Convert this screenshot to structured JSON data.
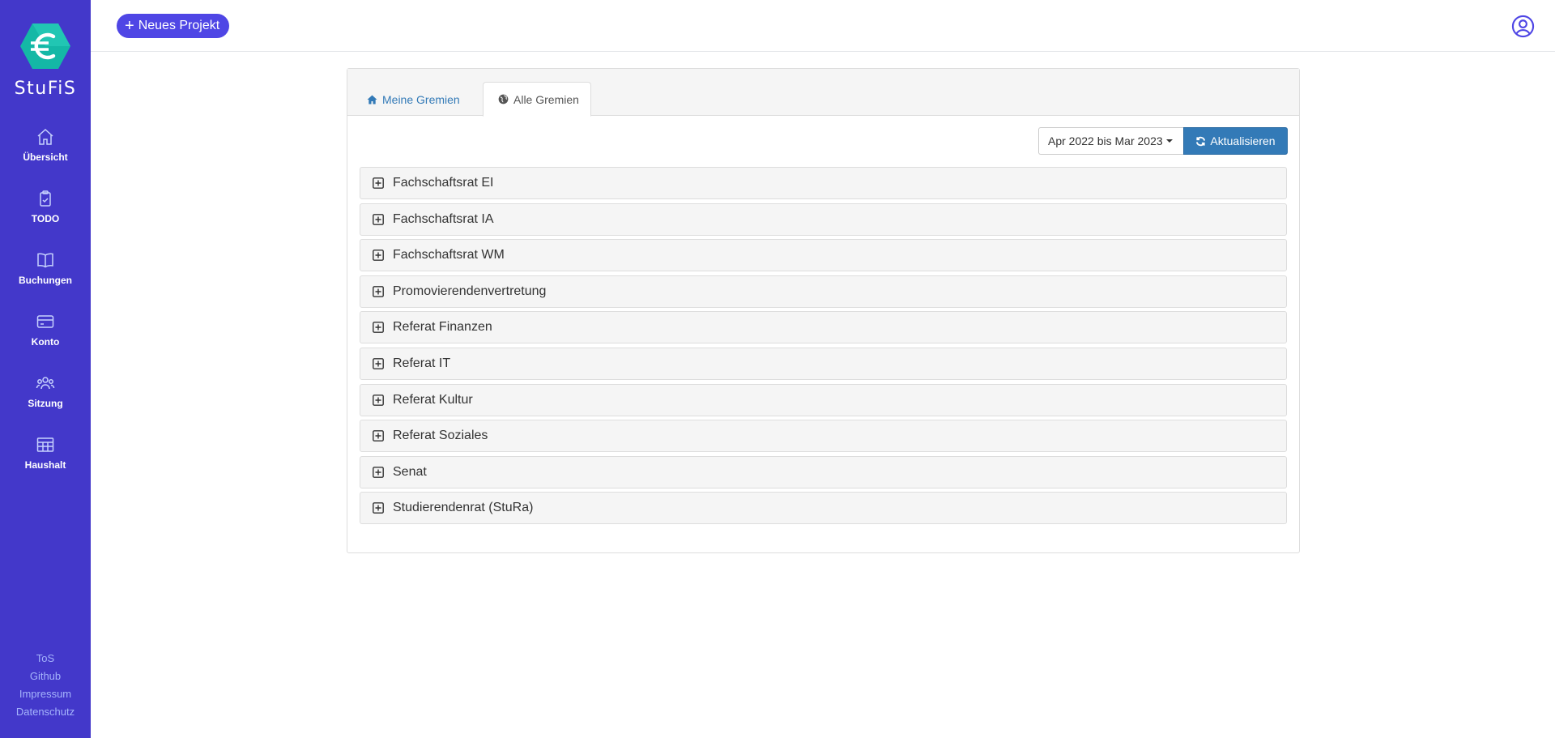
{
  "sidebar": {
    "brand": "StuFiS",
    "items": [
      {
        "label": "Übersicht",
        "icon": "home-icon"
      },
      {
        "label": "TODO",
        "icon": "clipboard-check-icon"
      },
      {
        "label": "Buchungen",
        "icon": "book-open-icon"
      },
      {
        "label": "Konto",
        "icon": "credit-card-icon"
      },
      {
        "label": "Sitzung",
        "icon": "user-group-icon"
      },
      {
        "label": "Haushalt",
        "icon": "table-icon"
      }
    ],
    "footer": [
      "ToS",
      "Github",
      "Impressum",
      "Datenschutz"
    ]
  },
  "header": {
    "new_project_label": "Neues Projekt"
  },
  "tabs": [
    {
      "label": "Meine Gremien",
      "icon": "home-icon",
      "active": false
    },
    {
      "label": "Alle Gremien",
      "icon": "globe-icon",
      "active": true
    }
  ],
  "toolbar": {
    "range_label": "Apr 2022 bis Mar 2023",
    "refresh_label": "Aktualisieren"
  },
  "groups": [
    "Fachschaftsrat EI",
    "Fachschaftsrat IA",
    "Fachschaftsrat WM",
    "Promovierendenvertretung",
    "Referat Finanzen",
    "Referat IT",
    "Referat Kultur",
    "Referat Soziales",
    "Senat",
    "Studierendenrat (StuRa)"
  ],
  "colors": {
    "sidebar": "#4338ca",
    "accent": "#4f46e5",
    "primary_button": "#337ab7"
  }
}
